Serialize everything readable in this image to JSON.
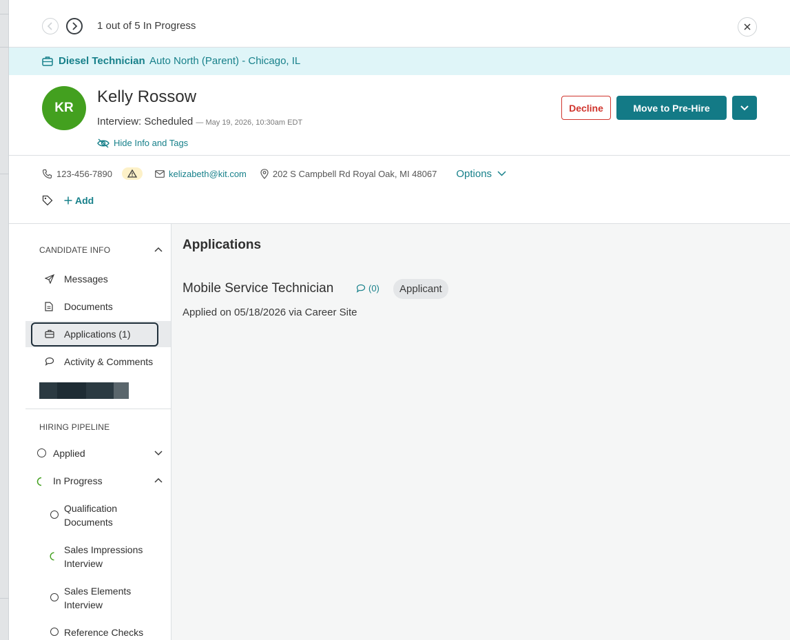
{
  "nav": {
    "counter": "1 out of 5 In Progress"
  },
  "job": {
    "title": "Diesel Technician",
    "location": "Auto North (Parent) - Chicago, IL"
  },
  "candidate": {
    "initials": "KR",
    "name": "Kelly Rossow",
    "status": "Interview: Scheduled",
    "status_date": "— May 19, 2026, 10:30am EDT",
    "hide_info_label": "Hide Info and Tags",
    "phone": "123-456-7890",
    "email": "kelizabeth@kit.com",
    "address": "202 S Campbell Rd Royal Oak, MI 48067",
    "options_label": "Options",
    "add_tag_label": "Add"
  },
  "actions": {
    "decline": "Decline",
    "move": "Move to Pre-Hire"
  },
  "sidebar": {
    "candidate_info_header": "CANDIDATE INFO",
    "items": [
      {
        "label": "Messages",
        "icon": "send-icon"
      },
      {
        "label": "Documents",
        "icon": "document-icon"
      },
      {
        "label": "Applications (1)",
        "icon": "briefcase-icon"
      },
      {
        "label": "Activity & Comments",
        "icon": "comment-icon"
      }
    ],
    "hiring_pipeline_header": "HIRING PIPELINE",
    "pipeline": [
      {
        "label": "Applied"
      },
      {
        "label": "In Progress"
      },
      {
        "label": "Qualification Documents"
      },
      {
        "label": "Sales Impressions Interview"
      },
      {
        "label": "Sales Elements Interview"
      },
      {
        "label": "Reference Checks"
      }
    ]
  },
  "main": {
    "title": "Applications",
    "application": {
      "title": "Mobile Service Technician",
      "comments": "(0)",
      "stage": "Applicant",
      "applied": "Applied on 05/18/2026 via Career Site"
    }
  },
  "colors": {
    "accent": "#137a86",
    "link": "#17808a",
    "decline": "#d0342c",
    "avatar": "#43a01f",
    "banner": "#dff5f8"
  }
}
